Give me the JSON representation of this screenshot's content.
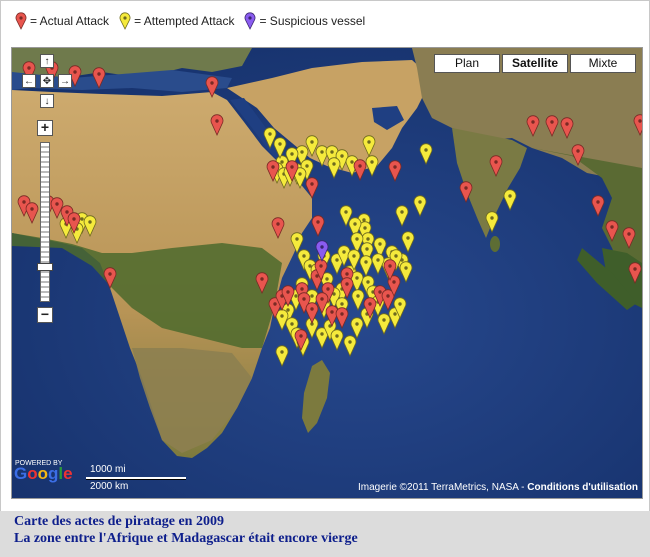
{
  "legend": {
    "items": [
      {
        "label": "= Actual Attack",
        "color": "#e8554e",
        "icon": "red-marker-icon"
      },
      {
        "label": "= Attempted Attack",
        "color": "#f5ea3c",
        "icon": "yellow-marker-icon"
      },
      {
        "label": "= Suspicious vessel",
        "color": "#8a5cf0",
        "icon": "purple-marker-icon"
      }
    ]
  },
  "map_types": {
    "plan": "Plan",
    "satellite": "Satellite",
    "mixte": "Mixte",
    "active": "Satellite"
  },
  "nav": {
    "up": "↑",
    "left": "←",
    "center": "✥",
    "right": "→",
    "down": "↓",
    "zoom_in": "+",
    "zoom_out": "−"
  },
  "zoom_level_fraction": 0.22,
  "logo": {
    "text": "Google",
    "powered": "POWERED BY"
  },
  "scale": {
    "imperial": "1000 mi",
    "metric": "2000 km"
  },
  "attribution": {
    "text": "Imagerie ©2011 TerraMetrics, NASA - ",
    "link": "Conditions d'utilisation"
  },
  "caption": {
    "line1": "Carte des actes de piratage en 2009",
    "line2": "La zone entre l'Afrique et Madagascar était encore vierge"
  },
  "colors": {
    "ocean": "#1c3a78",
    "land": "#8a7a52",
    "desert": "#c9a86a",
    "forest": "#4a6a2c"
  },
  "markers": {
    "red": [
      [
        17,
        34
      ],
      [
        40,
        34
      ],
      [
        63,
        38
      ],
      [
        87,
        40
      ],
      [
        200,
        49
      ],
      [
        205,
        87
      ],
      [
        261,
        133
      ],
      [
        280,
        133
      ],
      [
        300,
        150
      ],
      [
        306,
        188
      ],
      [
        348,
        132
      ],
      [
        383,
        133
      ],
      [
        454,
        154
      ],
      [
        484,
        128
      ],
      [
        521,
        88
      ],
      [
        540,
        88
      ],
      [
        555,
        90
      ],
      [
        566,
        117
      ],
      [
        586,
        168
      ],
      [
        600,
        193
      ],
      [
        617,
        200
      ],
      [
        623,
        235
      ],
      [
        628,
        87
      ],
      [
        12,
        168
      ],
      [
        20,
        175
      ],
      [
        36,
        168
      ],
      [
        45,
        170
      ],
      [
        55,
        178
      ],
      [
        62,
        185
      ],
      [
        98,
        240
      ],
      [
        250,
        245
      ],
      [
        263,
        270
      ],
      [
        270,
        262
      ],
      [
        276,
        258
      ],
      [
        289,
        302
      ],
      [
        305,
        242
      ],
      [
        309,
        232
      ],
      [
        316,
        255
      ],
      [
        320,
        278
      ],
      [
        330,
        280
      ],
      [
        358,
        270
      ],
      [
        368,
        258
      ],
      [
        376,
        262
      ],
      [
        382,
        248
      ],
      [
        378,
        232
      ],
      [
        266,
        190
      ],
      [
        290,
        255
      ],
      [
        292,
        265
      ],
      [
        300,
        275
      ],
      [
        310,
        265
      ],
      [
        335,
        240
      ],
      [
        335,
        250
      ]
    ],
    "yellow": [
      [
        357,
        108
      ],
      [
        360,
        128
      ],
      [
        408,
        168
      ],
      [
        390,
        178
      ],
      [
        396,
        204
      ],
      [
        352,
        186
      ],
      [
        353,
        194
      ],
      [
        356,
        205
      ],
      [
        334,
        178
      ],
      [
        343,
        190
      ],
      [
        345,
        205
      ],
      [
        355,
        215
      ],
      [
        368,
        210
      ],
      [
        380,
        218
      ],
      [
        376,
        230
      ],
      [
        390,
        226
      ],
      [
        394,
        234
      ],
      [
        384,
        222
      ],
      [
        356,
        248
      ],
      [
        361,
        258
      ],
      [
        300,
        108
      ],
      [
        290,
        118
      ],
      [
        280,
        120
      ],
      [
        270,
        128
      ],
      [
        265,
        135
      ],
      [
        272,
        140
      ],
      [
        285,
        136
      ],
      [
        295,
        132
      ],
      [
        310,
        118
      ],
      [
        320,
        118
      ],
      [
        330,
        122
      ],
      [
        340,
        128
      ],
      [
        322,
        130
      ],
      [
        258,
        100
      ],
      [
        268,
        110
      ],
      [
        278,
        138
      ],
      [
        288,
        140
      ],
      [
        498,
        162
      ],
      [
        414,
        116
      ],
      [
        480,
        184
      ],
      [
        70,
        185
      ],
      [
        78,
        188
      ],
      [
        54,
        190
      ],
      [
        65,
        195
      ],
      [
        285,
        205
      ],
      [
        292,
        222
      ],
      [
        298,
        232
      ],
      [
        305,
        236
      ],
      [
        312,
        222
      ],
      [
        325,
        226
      ],
      [
        338,
        238
      ],
      [
        345,
        244
      ],
      [
        330,
        255
      ],
      [
        322,
        260
      ],
      [
        312,
        270
      ],
      [
        300,
        262
      ],
      [
        290,
        250
      ],
      [
        284,
        262
      ],
      [
        276,
        276
      ],
      [
        280,
        290
      ],
      [
        285,
        300
      ],
      [
        291,
        308
      ],
      [
        270,
        318
      ],
      [
        310,
        300
      ],
      [
        318,
        292
      ],
      [
        325,
        302
      ],
      [
        338,
        308
      ],
      [
        345,
        290
      ],
      [
        355,
        280
      ],
      [
        346,
        262
      ],
      [
        366,
        268
      ],
      [
        372,
        286
      ],
      [
        383,
        280
      ],
      [
        388,
        270
      ],
      [
        270,
        282
      ],
      [
        300,
        290
      ],
      [
        330,
        270
      ],
      [
        315,
        245
      ],
      [
        332,
        218
      ],
      [
        342,
        222
      ],
      [
        354,
        228
      ],
      [
        366,
        226
      ]
    ],
    "purple": [
      [
        310,
        213
      ]
    ]
  }
}
